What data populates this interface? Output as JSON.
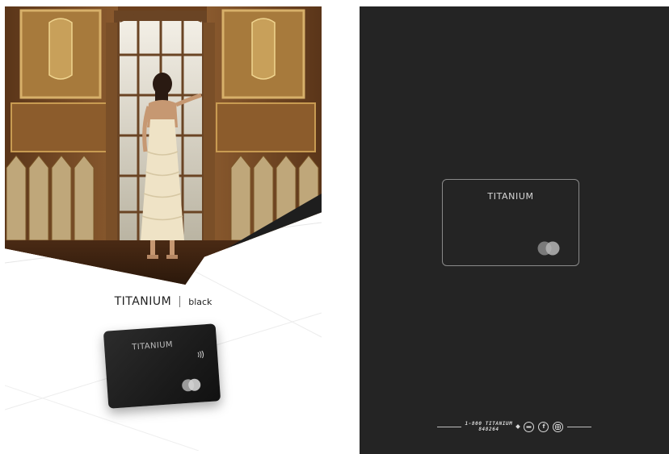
{
  "left_page": {
    "brand_name": "TITANIUM",
    "brand_tier": "black",
    "card": {
      "name": "TITANIUM"
    }
  },
  "right_page": {
    "card": {
      "name": "TITANIUM"
    },
    "footer": {
      "phone": "1-800 TITANIUM",
      "phone_number": "848264",
      "facebook_glyph": "f"
    }
  },
  "colors": {
    "right_background": "#242424",
    "card_black": "#1b1b1b",
    "outline": "#8a8a8a"
  },
  "icons": [
    "contactless-icon",
    "mastercard-logo",
    "mastercard-outline-logo",
    "whatsapp-icon",
    "facebook-icon",
    "instagram-icon"
  ]
}
